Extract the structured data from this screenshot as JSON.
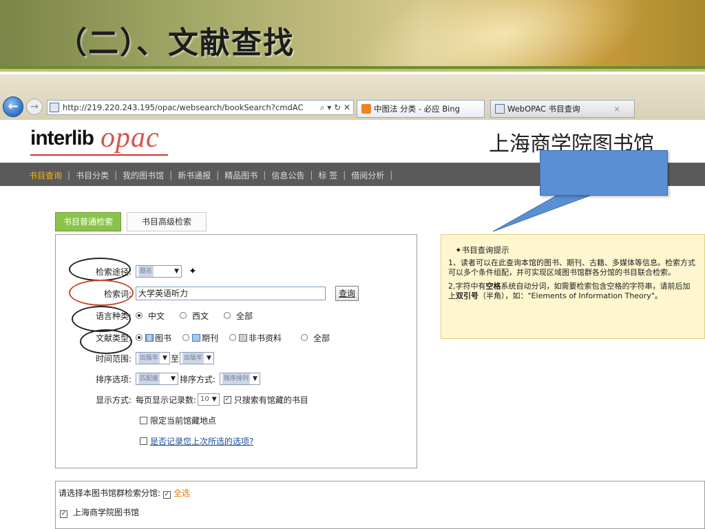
{
  "slide": {
    "title": "（二）、文献查找"
  },
  "browser": {
    "url": "http://219.220.243.195/opac/websearch/bookSearch?cmdAC",
    "tools": "⌕ ▾ ↻ ✕",
    "tabs": [
      {
        "label": "中图法 分类 - 必应 Bing"
      },
      {
        "label": "WebOPAC 书目查询",
        "close": "×"
      }
    ]
  },
  "header": {
    "logo_word": "interlib",
    "logo_opac": "opac",
    "library_name": "上海商学院图书馆"
  },
  "nav": {
    "items": [
      "书目查询",
      "书目分类",
      "我的图书馆",
      "新书通报",
      "精品图书",
      "信息公告",
      "标 签",
      "借阅分析"
    ],
    "separator": "|"
  },
  "search_tabs": {
    "basic": "书目普通检索",
    "advanced": "书目高级检索"
  },
  "form": {
    "route_label": "检索途径:",
    "route_value": "题名",
    "keyword_label": "检索词:",
    "keyword_value": "大学英语听力",
    "search_button": "查询",
    "lang_label": "语言种类:",
    "lang_options": [
      "中文",
      "西文",
      "全部"
    ],
    "doctype_label": "文献类型:",
    "doctype_options": [
      "图书",
      "期刊",
      "非书资料",
      "全部"
    ],
    "time_label": "时间范围:",
    "time_from": "出版年",
    "time_to_word": "至",
    "time_to": "出版年",
    "sort_label": "排序选项:",
    "sort_value": "匹配度",
    "sort_mode_label": "排序方式:",
    "sort_mode_value": "降序排列",
    "display_label": "显示方式:",
    "per_page_label": "每页显示记录数:",
    "per_page_value": "10",
    "only_held": "只搜索有馆藏的书目",
    "limit_location": "限定当前馆藏地点",
    "remember_option": "是否记录您上次所选的选项?"
  },
  "hint": {
    "title": "书目查询提示",
    "p1": "1、读者可以在此查询本馆的图书、期刊、古籍、多媒体等信息。检索方式可以多个条件组配，并可实现区域图书馆群各分馆的书目联合检索。",
    "p2_a": "2,字符中有",
    "p2_b": "空格",
    "p2_c": "系统自动分词，如需要检索包含空格的字符串，请前后加上",
    "p2_d": "双引号",
    "p2_e": "（半角），如：\"Elements of Information Theory\"。"
  },
  "bottom": {
    "label": "请选择本图书馆群检索分馆:",
    "select_all": "全选",
    "library": "上海商学院图书馆"
  },
  "colors": {
    "nav_bg": "#5a5a5a",
    "nav_active": "#ffb400",
    "tab_active": "#8bc34a",
    "hint_bg": "#fdf6cf",
    "callout": "#5b8fd4",
    "opac_red": "#d9534f"
  }
}
